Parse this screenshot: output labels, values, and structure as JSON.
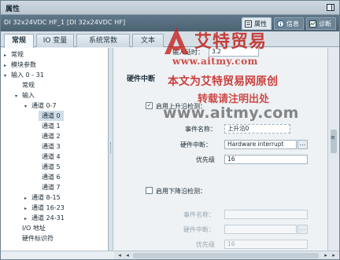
{
  "window": {
    "title": "属性"
  },
  "header": {
    "device_name": "DI 32x24VDC HF_1 [DI 32x24VDC HF]",
    "tabs": [
      {
        "icon": "properties-icon",
        "label": "属性"
      },
      {
        "icon": "info-icon",
        "label": "信息"
      },
      {
        "icon": "diagnostics-icon",
        "label": "诊断"
      }
    ]
  },
  "tabs": [
    {
      "label": "常规"
    },
    {
      "label": "IO 变量"
    },
    {
      "label": "系统常数"
    },
    {
      "label": "文本"
    }
  ],
  "tree": {
    "items": [
      {
        "label": "常规",
        "arrow": "▸"
      },
      {
        "label": "模块参数",
        "arrow": "▸"
      },
      {
        "label": "输入 0 - 31",
        "arrow": "▾"
      },
      {
        "label": "常规",
        "arrow": ""
      },
      {
        "label": "输入",
        "arrow": "▾"
      },
      {
        "label": "通道 0-7",
        "arrow": "▾"
      },
      {
        "label": "通道 0",
        "arrow": ""
      },
      {
        "label": "通道 1",
        "arrow": ""
      },
      {
        "label": "通道 2",
        "arrow": ""
      },
      {
        "label": "通道 3",
        "arrow": ""
      },
      {
        "label": "通道 4",
        "arrow": ""
      },
      {
        "label": "通道 5",
        "arrow": ""
      },
      {
        "label": "通道 6",
        "arrow": ""
      },
      {
        "label": "通道 7",
        "arrow": ""
      },
      {
        "label": "通道 8-15",
        "arrow": "▸"
      },
      {
        "label": "通道 16-23",
        "arrow": "▸"
      },
      {
        "label": "通道 24-31",
        "arrow": "▸"
      },
      {
        "label": "I/O 地址",
        "arrow": ""
      },
      {
        "label": "硬件标识符",
        "arrow": ""
      }
    ]
  },
  "content": {
    "top_field_label": "输入延时：",
    "top_field_value": "3.2",
    "hw_interrupt_title": "硬件中断",
    "rising_edge": {
      "checked": true,
      "label": "启用上升沿检测：",
      "event_name_label": "事件名称：",
      "event_name_value": "上升沿0",
      "hw_interrupt_label": "硬件中断：",
      "hw_interrupt_value": "Hardware interrupt",
      "priority_label": "优先级",
      "priority_value": "16",
      "browse_label": "..."
    },
    "falling_edge": {
      "checked": false,
      "label": "启用下降沿检测：",
      "event_name_label": "事件名称：",
      "event_name_value": "",
      "hw_interrupt_label": "硬件中断：",
      "hw_interrupt_value": "",
      "priority_label": "优先级",
      "priority_value": "16",
      "browse_label": "..."
    }
  },
  "watermark": {
    "brand": "艾特贸易",
    "url": "www.aitmy.com",
    "line1": "本文为艾特贸易网原创",
    "line2": "转载请注明出处",
    "url_large": "www.aitmy.com"
  },
  "colors": {
    "header_bg": "#566d7f",
    "selection": "#cfdde8",
    "watermark_red": "#c4221d"
  }
}
